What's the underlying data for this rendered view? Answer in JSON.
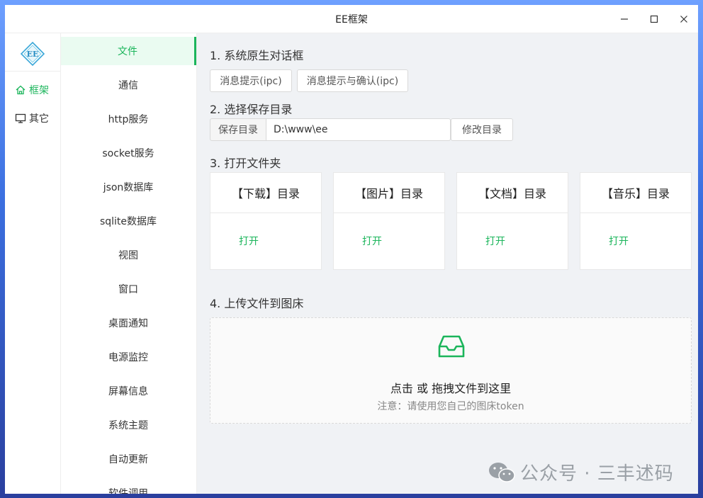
{
  "window": {
    "title": "EE框架"
  },
  "rail": {
    "items": [
      {
        "label": "框架",
        "icon": "home-icon"
      },
      {
        "label": "其它",
        "icon": "monitor-icon"
      }
    ]
  },
  "menu": {
    "items": [
      "文件",
      "通信",
      "http服务",
      "socket服务",
      "json数据库",
      "sqlite数据库",
      "视图",
      "窗口",
      "桌面通知",
      "电源监控",
      "屏幕信息",
      "系统主题",
      "自动更新",
      "软件调用"
    ]
  },
  "sections": {
    "s1": {
      "title": "1. 系统原生对话框",
      "btn1": "消息提示(ipc)",
      "btn2": "消息提示与确认(ipc)"
    },
    "s2": {
      "title": "2. 选择保存目录",
      "addon": "保存目录",
      "value": "D:\\www\\ee",
      "btn": "修改目录"
    },
    "s3": {
      "title": "3. 打开文件夹",
      "cards": [
        {
          "title": "【下载】目录",
          "link": "打开"
        },
        {
          "title": "【图片】目录",
          "link": "打开"
        },
        {
          "title": "【文档】目录",
          "link": "打开"
        },
        {
          "title": "【音乐】目录",
          "link": "打开"
        }
      ]
    },
    "s4": {
      "title": "4. 上传文件到图床",
      "drop_text": "点击 或 拖拽文件到这里",
      "hint": "注意：请使用您自己的图床token"
    }
  },
  "watermark": {
    "text": "公众号 · 三丰述码"
  },
  "colors": {
    "accent": "#1bb55b",
    "content_bg": "#f0f2f5"
  }
}
